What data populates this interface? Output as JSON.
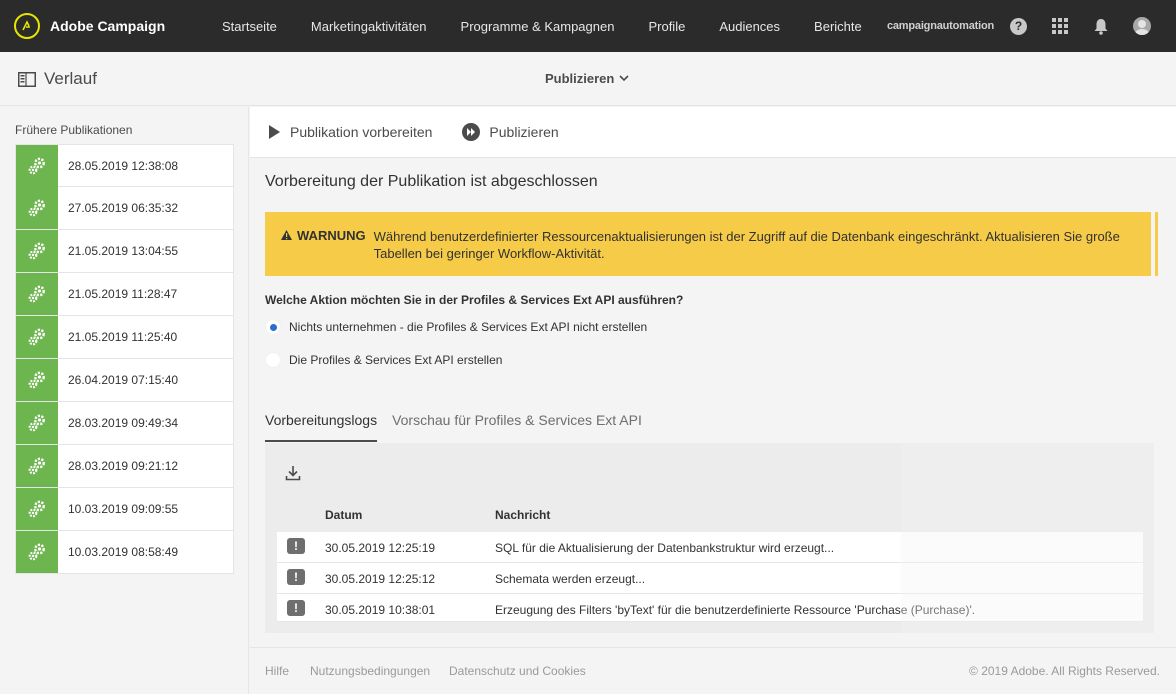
{
  "app": {
    "brand": "Adobe Campaign",
    "org": "campaignautomation"
  },
  "nav": [
    "Startseite",
    "Marketingaktivitäten",
    "Programme & Kampagnen",
    "Profile",
    "Audiences",
    "Berichte"
  ],
  "header": {
    "history_label": "Verlauf",
    "publish_menu": "Publizieren"
  },
  "sidebar": {
    "title": "Frühere Publikationen",
    "items": [
      "28.05.2019 12:38:08",
      "27.05.2019 06:35:32",
      "21.05.2019 13:04:55",
      "21.05.2019 11:28:47",
      "21.05.2019 11:25:40",
      "26.04.2019 07:15:40",
      "28.03.2019 09:49:34",
      "28.03.2019 09:21:12",
      "10.03.2019 09:09:55",
      "10.03.2019 08:58:49"
    ]
  },
  "toolbar": {
    "prepare": "Publikation vorbereiten",
    "publish": "Publizieren"
  },
  "main": {
    "status_title": "Vorbereitung der Publikation ist abgeschlossen",
    "warning_label": "WARNUNG",
    "warning_text": "Während benutzerdefinierter Ressourcenaktualisierungen ist der Zugriff auf die Datenbank eingeschränkt. Aktualisieren Sie große Tabellen bei geringer Workflow-Aktivität.",
    "question": "Welche Aktion möchten Sie in der Profiles & Services Ext API ausführen?",
    "options": [
      {
        "label": "Nichts unternehmen - die Profiles & Services Ext API nicht erstellen",
        "selected": true
      },
      {
        "label": "Die Profiles & Services Ext API erstellen",
        "selected": false
      }
    ],
    "tabs": [
      "Vorbereitungslogs",
      "Vorschau für Profiles & Services Ext API"
    ]
  },
  "logs": {
    "col_date": "Datum",
    "col_message": "Nachricht",
    "rows": [
      {
        "date": "30.05.2019 12:25:19",
        "message": "SQL für die Aktualisierung der Datenbankstruktur wird erzeugt..."
      },
      {
        "date": "30.05.2019 12:25:12",
        "message": "Schemata werden erzeugt..."
      },
      {
        "date": "30.05.2019 10:38:01",
        "message": "Erzeugung des Filters 'byText' für die benutzerdefinierte Ressource 'Purchase (Purchase)'."
      }
    ]
  },
  "footer": {
    "links": [
      "Hilfe",
      "Nutzungsbedingungen",
      "Datenschutz und Cookies"
    ],
    "copyright": "© 2019 Adobe. All Rights Reserved."
  },
  "colors": {
    "nav_bg": "#2b2b2b",
    "pub_green": "#6db54e",
    "warning_bg": "#f6cb47",
    "radio_blue": "#2d6fcf"
  }
}
